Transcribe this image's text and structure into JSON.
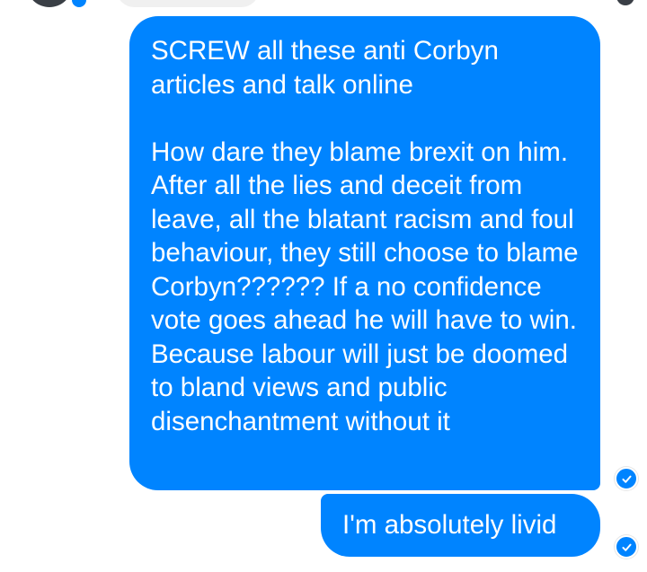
{
  "conversation": {
    "header_partial": {
      "avatar_icon": "user-avatar",
      "online_indicator_color": "#0084ff"
    },
    "messages": [
      {
        "direction": "outgoing",
        "text": "SCREW all these anti Corbyn articles and talk online\n\nHow dare they blame brexit on him. After all the lies and deceit from leave, all the blatant racism and foul behaviour, they still choose to blame Corbyn?????? If a no confidence vote goes ahead he will have to win. Because labour will just be doomed to bland views and public disenchantment without it",
        "status_icon": "delivered-check-icon"
      },
      {
        "direction": "outgoing",
        "text": "I'm absolutely livid",
        "status_icon": "delivered-check-icon"
      }
    ],
    "colors": {
      "outgoing_bubble": "#0084ff",
      "incoming_bubble": "#f0f0f0",
      "background": "#ffffff",
      "text_on_bubble": "#ffffff"
    }
  }
}
